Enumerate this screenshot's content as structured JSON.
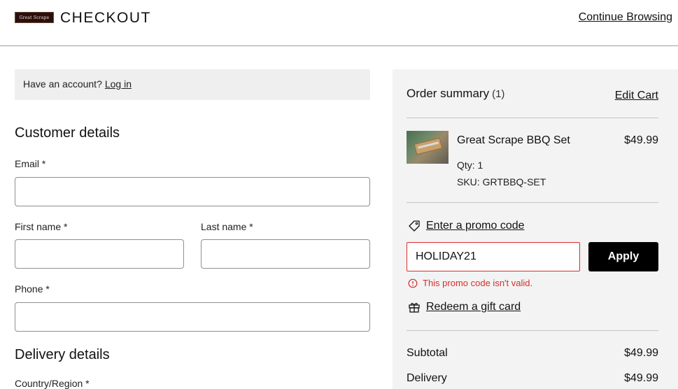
{
  "header": {
    "logo_text": "Great Scrape",
    "title": "CHECKOUT",
    "continue_link": "Continue Browsing"
  },
  "account": {
    "prompt": "Have an account?",
    "login_link": "Log in"
  },
  "customer": {
    "title": "Customer details",
    "email_label": "Email *",
    "first_name_label": "First name *",
    "last_name_label": "Last name *",
    "phone_label": "Phone *"
  },
  "delivery": {
    "title": "Delivery details",
    "country_label": "Country/Region *"
  },
  "summary": {
    "title": "Order summary",
    "count": "(1)",
    "edit_cart": "Edit Cart",
    "item": {
      "name": "Great Scrape BBQ Set",
      "price": "$49.99",
      "qty": "Qty: 1",
      "sku": "SKU: GRTBBQ-SET"
    },
    "promo_link": "Enter a promo code",
    "promo_value": "HOLIDAY21",
    "apply_label": "Apply",
    "promo_error": "This promo code isn't valid.",
    "gift_link": "Redeem a gift card",
    "subtotal_label": "Subtotal",
    "subtotal_value": "$49.99",
    "delivery_label": "Delivery",
    "delivery_value": "$49.99"
  },
  "colors": {
    "error": "#d62d2d",
    "button": "#000000",
    "summary_bg": "#f3f3f3"
  }
}
